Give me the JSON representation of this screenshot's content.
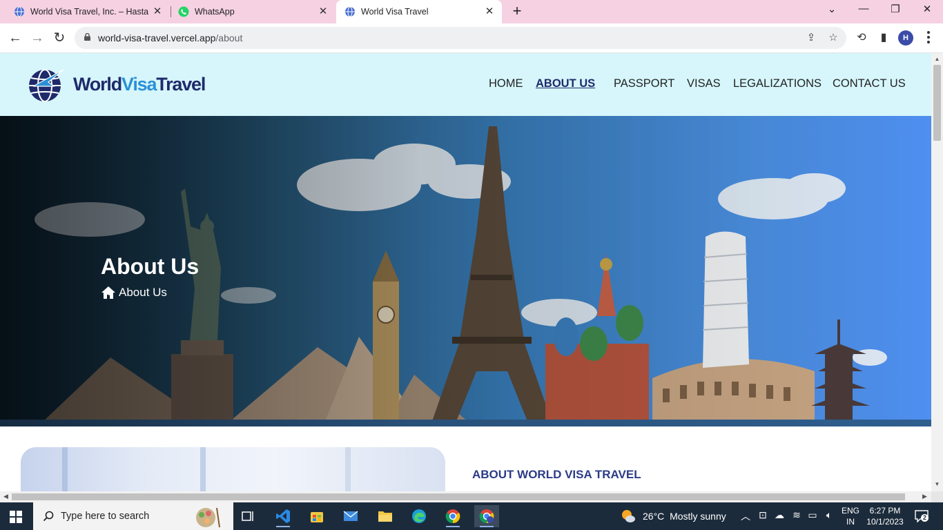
{
  "browser": {
    "tabs": [
      {
        "title": "World Visa Travel, Inc. – Hasta 'la",
        "icon": "globe-icon",
        "active": false
      },
      {
        "title": "WhatsApp",
        "icon": "whatsapp-icon",
        "active": false
      },
      {
        "title": "World Visa Travel",
        "icon": "globe-icon",
        "active": true
      }
    ],
    "new_tab_label": "+",
    "url_host": "world-visa-travel.vercel.app",
    "url_path": "/about",
    "profile_initial": "H"
  },
  "site": {
    "logo": {
      "part1": "World",
      "part2": "Visa",
      "part3": "Travel"
    },
    "nav": [
      {
        "label": "HOME",
        "active": false
      },
      {
        "label": "ABOUT US",
        "active": true
      },
      {
        "label": "PASSPORT",
        "active": false
      },
      {
        "label": "VISAS",
        "active": false
      },
      {
        "label": "LEGALIZATIONS",
        "active": false
      },
      {
        "label": "CONTACT US",
        "active": false
      }
    ],
    "hero": {
      "title": "About Us",
      "breadcrumb_arrow": "→",
      "breadcrumb_current": "About Us"
    },
    "about": {
      "heading": "ABOUT WORLD VISA TRAVEL"
    }
  },
  "taskbar": {
    "search_placeholder": "Type here to search",
    "weather": {
      "temp": "26°C",
      "condition": "Mostly sunny"
    },
    "language": {
      "line1": "ENG",
      "line2": "IN"
    },
    "clock": {
      "time": "6:27 PM",
      "date": "10/1/2023"
    },
    "notification_count": "2"
  },
  "colors": {
    "accent": "#1f2a6b",
    "header_bg": "#d6f6fb",
    "tab_strip": "#f5d1e2"
  }
}
